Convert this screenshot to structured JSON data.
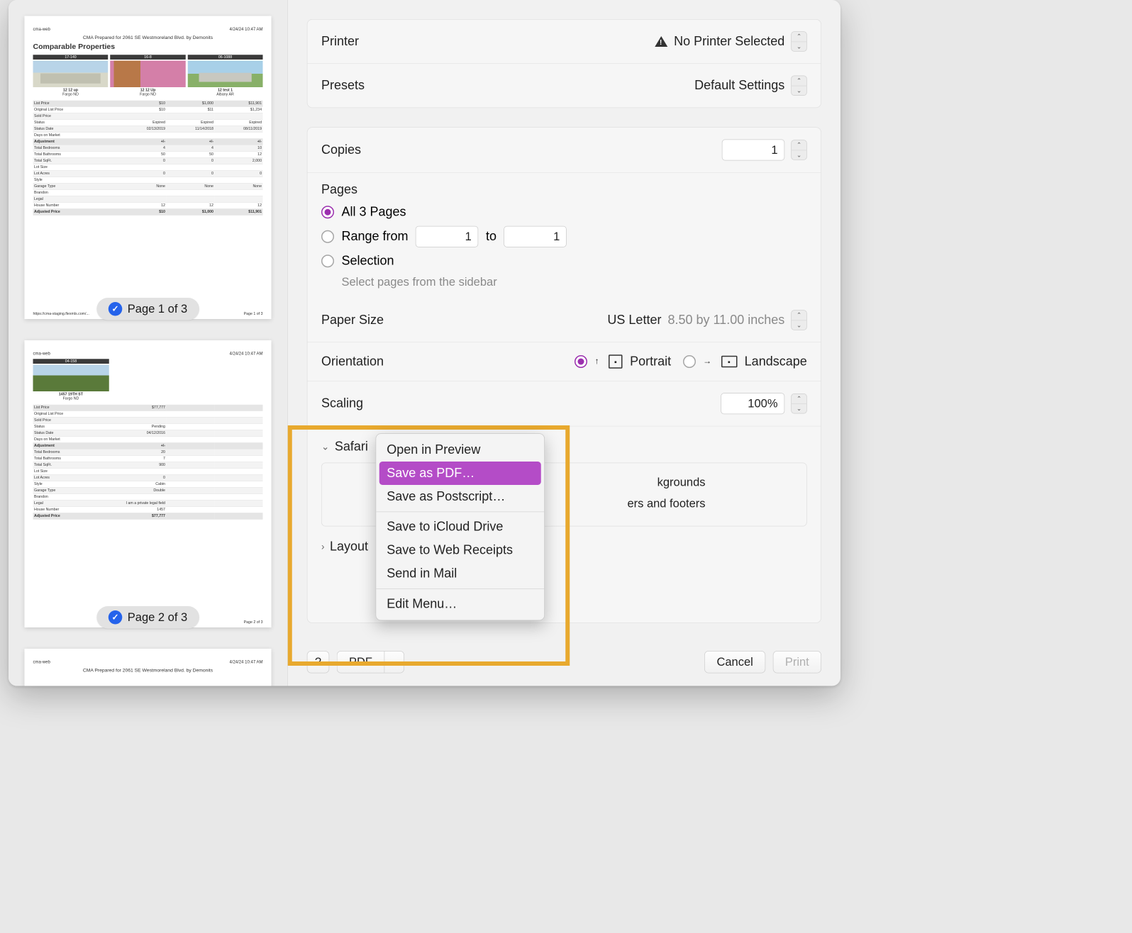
{
  "sidebar": {
    "thumb1": {
      "header_left": "cma-web",
      "header_right": "4/24/24 10:47 AM",
      "subhead": "CMA Prepared for 2061 SE Westmoreland Blvd. by Demonits",
      "title": "Comparable Properties",
      "cols": [
        {
          "id": "17-140",
          "img": "photo1",
          "cap1": "12 12 up",
          "cap2": "Fargo ND"
        },
        {
          "id": "16-8",
          "img": "photo2",
          "cap1": "12 12 Up",
          "cap2": "Fargo ND"
        },
        {
          "id": "06-1088",
          "img": "photo3",
          "cap1": "12 test 1",
          "cap2": "Albany AR"
        }
      ],
      "rows": [
        {
          "label": "List Price",
          "v": [
            "$10",
            "$1,000",
            "$11,901"
          ],
          "cls": "dark"
        },
        {
          "label": "Original List Price",
          "v": [
            "$10",
            "$11",
            "$1,234"
          ]
        },
        {
          "label": "Sold Price",
          "v": [
            "",
            "",
            ""
          ],
          "cls": "shaded"
        },
        {
          "label": "Status",
          "v": [
            "Expired",
            "Expired",
            "Expired"
          ]
        },
        {
          "label": "Status Date",
          "v": [
            "02/13/2019",
            "11/14/2018",
            "08/11/2019"
          ],
          "cls": "shaded"
        },
        {
          "label": "Days on Market",
          "v": [
            "",
            "",
            ""
          ]
        },
        {
          "label": "Adjustment",
          "v": [
            "+/-",
            "+/-",
            "+/-"
          ],
          "cls": "dark bold"
        },
        {
          "label": "Total Bedrooms",
          "v": [
            "4",
            "4",
            "10"
          ],
          "cls": "shaded"
        },
        {
          "label": "Total Bathrooms",
          "v": [
            "50",
            "50",
            "12"
          ]
        },
        {
          "label": "Total SqFt.",
          "v": [
            "0",
            "0",
            "2,000"
          ],
          "cls": "shaded"
        },
        {
          "label": "Lot Size",
          "v": [
            "",
            "",
            ""
          ]
        },
        {
          "label": "Lot Acres",
          "v": [
            "0",
            "0",
            "0"
          ],
          "cls": "shaded"
        },
        {
          "label": "Style",
          "v": [
            "",
            "",
            ""
          ]
        },
        {
          "label": "Garage Type",
          "v": [
            "None",
            "None",
            "None"
          ],
          "cls": "shaded"
        },
        {
          "label": "Brandon",
          "v": [
            "",
            "",
            ""
          ]
        },
        {
          "label": "Legal",
          "v": [
            "",
            "",
            ""
          ],
          "cls": "shaded"
        },
        {
          "label": "House Number",
          "v": [
            "12",
            "12",
            "12"
          ]
        },
        {
          "label": "Adjusted Price",
          "v": [
            "$10",
            "$1,000",
            "$11,901"
          ],
          "cls": "dark bold"
        }
      ],
      "footer_left": "https://cma-staging.flexmls.com/...",
      "footer_right": "Page 1 of 3",
      "badge": "Page 1 of 3"
    },
    "thumb2": {
      "header_left": "cma-web",
      "header_right": "4/24/24 10:47 AM",
      "col": {
        "id": "04-158",
        "img": "photo4",
        "cap1": "1457 19TH ST",
        "cap2": "Fargo ND"
      },
      "rows": [
        {
          "label": "List Price",
          "v": [
            "$77,777"
          ],
          "cls": "dark"
        },
        {
          "label": "Original List Price",
          "v": [
            ""
          ]
        },
        {
          "label": "Sold Price",
          "v": [
            ""
          ],
          "cls": "shaded"
        },
        {
          "label": "Status",
          "v": [
            "Pending"
          ]
        },
        {
          "label": "Status Date",
          "v": [
            "04/12/2016"
          ],
          "cls": "shaded"
        },
        {
          "label": "Days on Market",
          "v": [
            ""
          ]
        },
        {
          "label": "Adjustment",
          "v": [
            "+/-"
          ],
          "cls": "dark bold"
        },
        {
          "label": "Total Bedrooms",
          "v": [
            "20"
          ],
          "cls": "shaded"
        },
        {
          "label": "Total Bathrooms",
          "v": [
            "7"
          ]
        },
        {
          "label": "Total SqFt.",
          "v": [
            "900"
          ],
          "cls": "shaded"
        },
        {
          "label": "Lot Size",
          "v": [
            ""
          ]
        },
        {
          "label": "Lot Acres",
          "v": [
            "0"
          ],
          "cls": "shaded"
        },
        {
          "label": "Style",
          "v": [
            "Cabin"
          ]
        },
        {
          "label": "Garage Type",
          "v": [
            "Double"
          ],
          "cls": "shaded"
        },
        {
          "label": "Brandon",
          "v": [
            ""
          ]
        },
        {
          "label": "Legal",
          "v": [
            "I am a private legal field"
          ],
          "cls": "shaded"
        },
        {
          "label": "House Number",
          "v": [
            "1457"
          ]
        },
        {
          "label": "Adjusted Price",
          "v": [
            "$77,777"
          ],
          "cls": "dark bold"
        }
      ],
      "footer_right": "Page 2 of 3",
      "badge": "Page 2 of 3"
    },
    "thumb3": {
      "header_left": "cma-web",
      "header_right": "4/24/24 10:47 AM",
      "subhead": "CMA Prepared for 2061 SE Westmoreland Blvd. by Demonits"
    }
  },
  "printer": {
    "label": "Printer",
    "value": "No Printer Selected"
  },
  "presets": {
    "label": "Presets",
    "value": "Default Settings"
  },
  "copies": {
    "label": "Copies",
    "value": "1"
  },
  "pages": {
    "label": "Pages",
    "all_label": "All 3 Pages",
    "range_label": "Range from",
    "range_to": "to",
    "range_from_val": "1",
    "range_to_val": "1",
    "selection_label": "Selection",
    "selection_hint": "Select pages from the sidebar"
  },
  "paper": {
    "label": "Paper Size",
    "value": "US Letter",
    "dims": "8.50 by 11.00 inches"
  },
  "orientation": {
    "label": "Orientation",
    "portrait": "Portrait",
    "landscape": "Landscape"
  },
  "scaling": {
    "label": "Scaling",
    "value": "100%"
  },
  "safari": {
    "label": "Safari",
    "option1_tail": "kgrounds",
    "option2_tail": "ers and footers"
  },
  "layout": {
    "label": "Layout"
  },
  "bottom": {
    "help": "?",
    "pdf": "PDF",
    "cancel": "Cancel",
    "print": "Print"
  },
  "popup": {
    "items": [
      "Open in Preview",
      "Save as PDF…",
      "Save as Postscript…",
      "Save to iCloud Drive",
      "Save to Web Receipts",
      "Send in Mail",
      "Edit Menu…"
    ]
  }
}
